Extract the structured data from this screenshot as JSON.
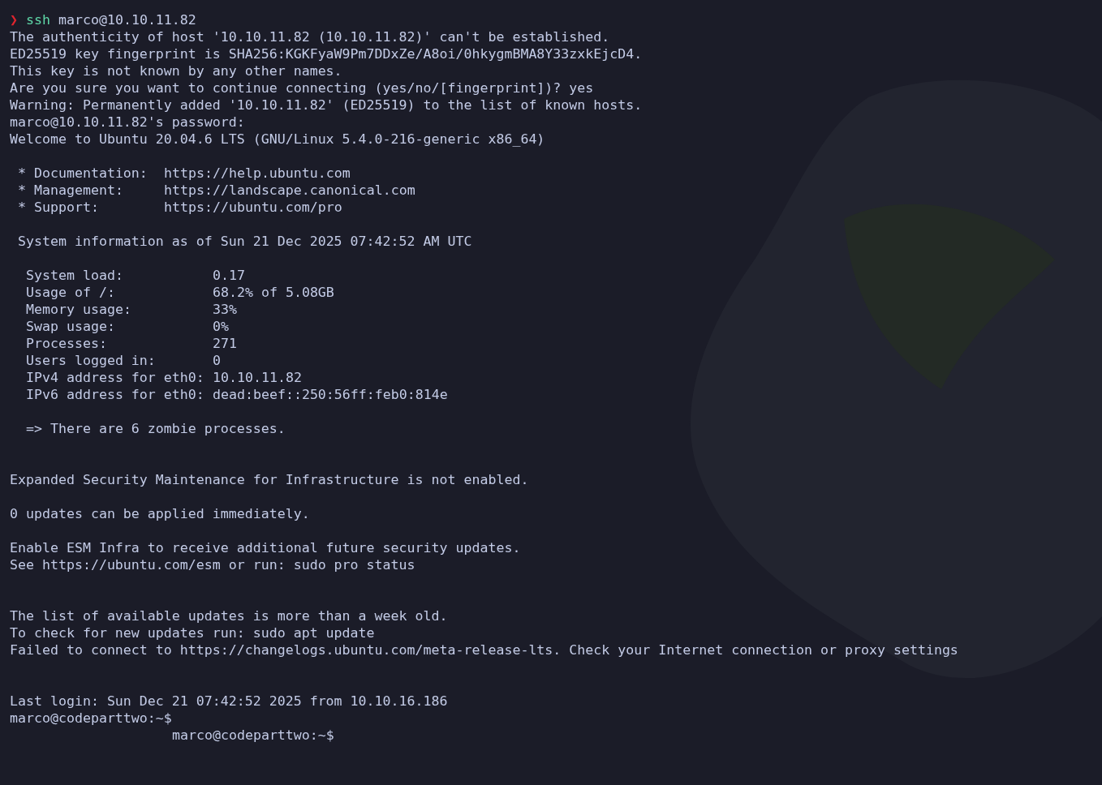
{
  "terminal": {
    "lines": [
      {
        "kind": "command",
        "symbol": "❯",
        "command": "ssh",
        "args": "marco@10.10.11.82"
      },
      {
        "kind": "text",
        "text": "The authenticity of host '10.10.11.82 (10.10.11.82)' can't be established."
      },
      {
        "kind": "text",
        "text": "ED25519 key fingerprint is SHA256:KGKFyaW9Pm7DDxZe/A8oi/0hkygmBMA8Y33zxkEjcD4."
      },
      {
        "kind": "text",
        "text": "This key is not known by any other names."
      },
      {
        "kind": "text",
        "text": "Are you sure you want to continue connecting (yes/no/[fingerprint])? yes"
      },
      {
        "kind": "text",
        "text": "Warning: Permanently added '10.10.11.82' (ED25519) to the list of known hosts."
      },
      {
        "kind": "text",
        "text": "marco@10.10.11.82's password:"
      },
      {
        "kind": "text",
        "text": "Welcome to Ubuntu 20.04.6 LTS (GNU/Linux 5.4.0-216-generic x86_64)"
      },
      {
        "kind": "blank"
      },
      {
        "kind": "link",
        "label": "* Documentation:",
        "url": "https://help.ubuntu.com"
      },
      {
        "kind": "link",
        "label": "* Management:",
        "url": "https://landscape.canonical.com"
      },
      {
        "kind": "link",
        "label": "* Support:",
        "url": "https://ubuntu.com/pro"
      },
      {
        "kind": "blank"
      },
      {
        "kind": "note",
        "text": "System information as of Sun 21 Dec 2025 07:42:52 AM UTC"
      },
      {
        "kind": "blank"
      },
      {
        "kind": "stat",
        "label": "System load:",
        "value": "0.17"
      },
      {
        "kind": "stat",
        "label": "Usage of /:",
        "value": "68.2% of 5.08GB"
      },
      {
        "kind": "stat",
        "label": "Memory usage:",
        "value": "33%"
      },
      {
        "kind": "stat",
        "label": "Swap usage:",
        "value": "0%"
      },
      {
        "kind": "stat",
        "label": "Processes:",
        "value": "271"
      },
      {
        "kind": "stat",
        "label": "Users logged in:",
        "value": "0"
      },
      {
        "kind": "stat",
        "label": "IPv4 address for eth0:",
        "value": "10.10.11.82"
      },
      {
        "kind": "stat",
        "label": "IPv6 address for eth0:",
        "value": "dead:beef::250:56ff:feb0:814e"
      },
      {
        "kind": "blank"
      },
      {
        "kind": "indent2",
        "text": "=> There are 6 zombie processes."
      },
      {
        "kind": "blank"
      },
      {
        "kind": "blank"
      },
      {
        "kind": "text",
        "text": "Expanded Security Maintenance for Infrastructure is not enabled."
      },
      {
        "kind": "blank"
      },
      {
        "kind": "text",
        "text": "0 updates can be applied immediately."
      },
      {
        "kind": "blank"
      },
      {
        "kind": "text",
        "text": "Enable ESM Infra to receive additional future security updates."
      },
      {
        "kind": "text",
        "text": "See https://ubuntu.com/esm or run: sudo pro status"
      },
      {
        "kind": "blank"
      },
      {
        "kind": "blank"
      },
      {
        "kind": "text",
        "text": "The list of available updates is more than a week old."
      },
      {
        "kind": "text",
        "text": "To check for new updates run: sudo apt update"
      },
      {
        "kind": "text",
        "text": "Failed to connect to https://changelogs.ubuntu.com/meta-release-lts. Check your Internet connection or proxy settings"
      },
      {
        "kind": "blank"
      },
      {
        "kind": "blank"
      },
      {
        "kind": "text",
        "text": "Last login: Sun Dec 21 07:42:52 2025 from 10.10.16.186"
      },
      {
        "kind": "text",
        "text": "marco@codeparttwo:~$"
      },
      {
        "kind": "indent20",
        "text": "marco@codeparttwo:~$"
      }
    ]
  }
}
